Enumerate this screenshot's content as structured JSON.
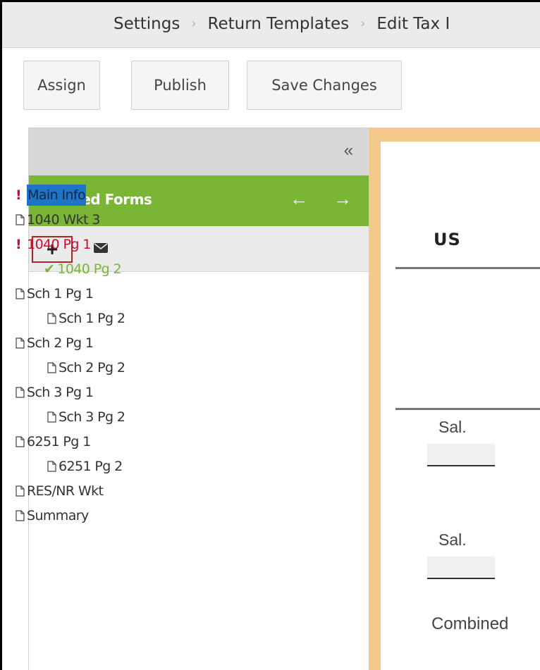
{
  "breadcrumb": {
    "items": [
      "Settings",
      "Return Templates",
      "Edit Tax I"
    ],
    "separator": "›"
  },
  "toolbar": {
    "assign_label": "Assign",
    "publish_label": "Publish",
    "save_label": "Save Changes"
  },
  "sidebar": {
    "collapse_icon": "«",
    "title": "Loaded Forms",
    "prev_icon": "←",
    "next_icon": "→",
    "add_icon": "+",
    "mail_icon": "envelope-icon",
    "forms": [
      {
        "label": "Main Info",
        "status": "error",
        "selected": true
      },
      {
        "label": "1040 Wkt 3",
        "status": "doc"
      },
      {
        "label": "1040 Pg 1",
        "status": "error"
      },
      {
        "label": "1040 Pg 2",
        "status": "complete"
      },
      {
        "label": "Sch 1 Pg 1",
        "status": "doc"
      },
      {
        "label": "Sch 1 Pg 2",
        "status": "doc"
      },
      {
        "label": "Sch 2 Pg 1",
        "status": "doc"
      },
      {
        "label": "Sch 2 Pg 2",
        "status": "doc"
      },
      {
        "label": "Sch 3 Pg 1",
        "status": "doc"
      },
      {
        "label": "Sch 3 Pg 2",
        "status": "doc"
      },
      {
        "label": "6251 Pg 1",
        "status": "doc"
      },
      {
        "label": "6251 Pg 2",
        "status": "doc"
      },
      {
        "label": "RES/NR Wkt",
        "status": "doc"
      },
      {
        "label": "Summary",
        "status": "doc"
      }
    ]
  },
  "form": {
    "us_label": "US",
    "sal_label_1": "Sal.",
    "sal_label_2": "Sal.",
    "combined_label": "Combined"
  },
  "colors": {
    "green": "#7ab535",
    "error_red": "#c8102e",
    "selection_blue": "#1f74c8",
    "form_border": "#f4c98c"
  }
}
